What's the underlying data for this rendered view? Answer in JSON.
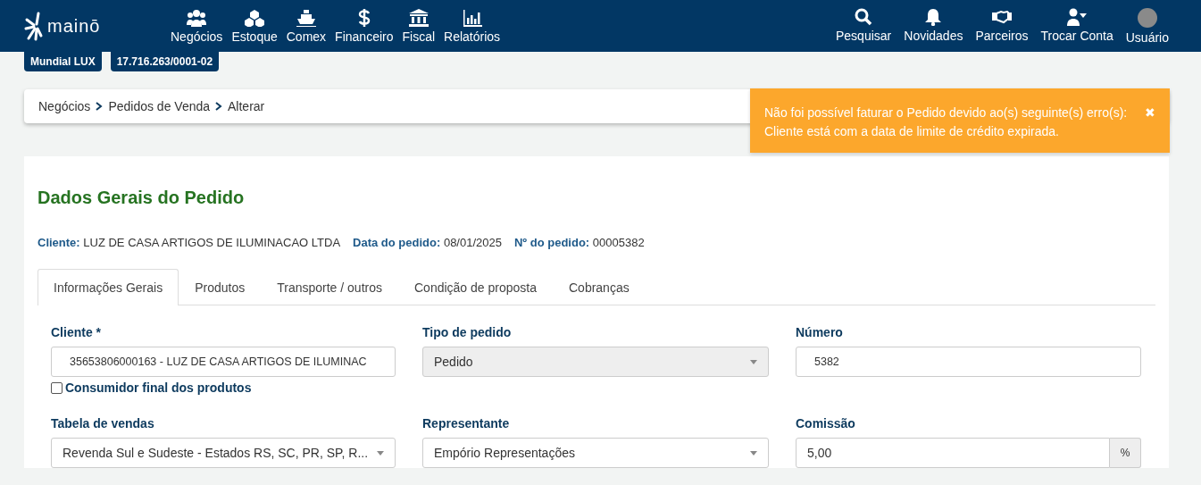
{
  "header": {
    "logo": "mainō",
    "nav": [
      "Negócios",
      "Estoque",
      "Comex",
      "Financeiro",
      "Fiscal",
      "Relatórios"
    ],
    "actions": [
      "Pesquisar",
      "Novidades",
      "Parceiros",
      "Trocar Conta",
      "Usuário"
    ]
  },
  "badges": [
    "Mundial LUX",
    "17.716.263/0001-02"
  ],
  "breadcrumb": [
    "Negócios",
    "Pedidos de Venda",
    "Alterar"
  ],
  "toast": {
    "lines": [
      "Não foi possível faturar o Pedido devido ao(s) seguinte(s) erro(s):",
      "Cliente está com a data de limite de crédito expirada."
    ],
    "close": "✖"
  },
  "title": "Dados Gerais do Pedido",
  "summary": [
    {
      "label": "Cliente:",
      "value": "LUZ DE CASA ARTIGOS DE ILUMINACAO LTDA"
    },
    {
      "label": "Data do pedido:",
      "value": "08/01/2025"
    },
    {
      "label": "Nº do pedido:",
      "value": "00005382"
    }
  ],
  "tabs": [
    {
      "label": "Informações Gerais",
      "selected": true
    },
    {
      "label": "Produtos",
      "selected": false
    },
    {
      "label": "Transporte / outros",
      "selected": false
    },
    {
      "label": "Condição de proposta",
      "selected": false
    },
    {
      "label": "Cobranças",
      "selected": false
    }
  ],
  "fields": [
    {
      "kind": "text",
      "label": "Cliente *",
      "value": "35653806000163 - LUZ DE CASA ARTIGOS DE ILUMINAC",
      "disabled": false,
      "checkbox": {
        "label": "Consumidor final dos produtos",
        "checked": false
      }
    },
    {
      "kind": "select",
      "label": "Tipo de pedido",
      "value": "Pedido",
      "disabled": true
    },
    {
      "kind": "text",
      "label": "Número",
      "value": "5382",
      "disabled": false
    },
    {
      "kind": "select",
      "label": "Tabela de vendas",
      "value": "Revenda Sul e Sudeste - Estados RS, SC, PR, SP, R...",
      "disabled": false
    },
    {
      "kind": "select",
      "label": "Representante",
      "value": "Empório Representações",
      "disabled": false
    },
    {
      "kind": "addon",
      "label": "Comissão",
      "value": "5,00",
      "addon": "%",
      "disabled": false
    }
  ]
}
